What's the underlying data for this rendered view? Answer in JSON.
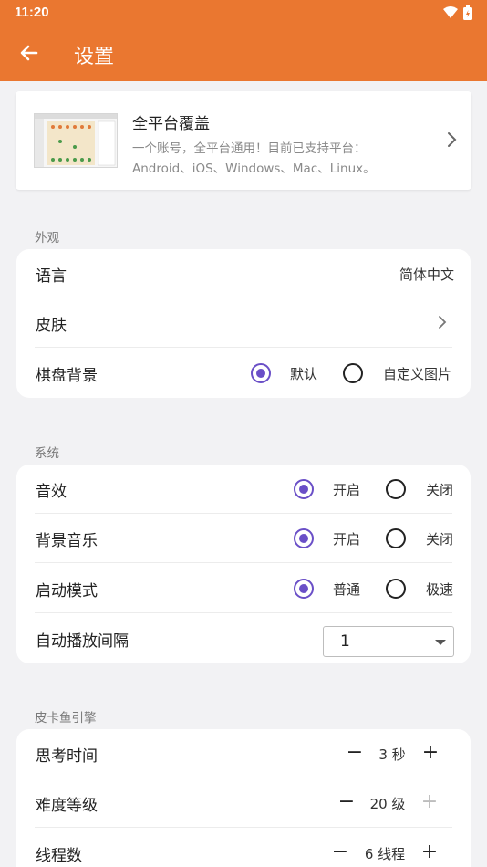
{
  "status": {
    "time": "11:20"
  },
  "header": {
    "title": "设置"
  },
  "promo": {
    "title": "全平台覆盖",
    "desc_line1": "一个账号，全平台通用！目前已支持平台：",
    "desc_line2": "Android、iOS、Windows、Mac、Linux。"
  },
  "appearance": {
    "section_title": "外观",
    "language": {
      "label": "语言",
      "value": "简体中文"
    },
    "skin": {
      "label": "皮肤"
    },
    "board_bg": {
      "label": "棋盘背景",
      "options": [
        "默认",
        "自定义图片"
      ],
      "selected": 0
    }
  },
  "system": {
    "section_title": "系统",
    "sound": {
      "label": "音效",
      "options": [
        "开启",
        "关闭"
      ],
      "selected": 0
    },
    "music": {
      "label": "背景音乐",
      "options": [
        "开启",
        "关闭"
      ],
      "selected": 0
    },
    "startup": {
      "label": "启动模式",
      "options": [
        "普通",
        "极速"
      ],
      "selected": 0
    },
    "autoplay": {
      "label": "自动播放间隔",
      "value": "1"
    }
  },
  "engine": {
    "section_title": "皮卡鱼引擎",
    "think_time": {
      "label": "思考时间",
      "value": "3 秒",
      "minus": "−",
      "plus": "+"
    },
    "difficulty": {
      "label": "难度等级",
      "value": "20 级",
      "minus": "−",
      "plus": "+"
    },
    "threads": {
      "label": "线程数",
      "value": "6 线程",
      "minus": "−",
      "plus": "+"
    }
  },
  "colors": {
    "accent": "#ea7730",
    "radio": "#6a4fc7"
  }
}
